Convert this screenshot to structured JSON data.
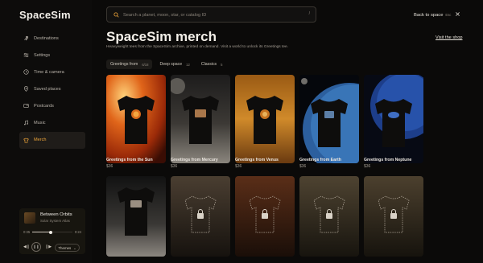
{
  "app": {
    "name": "SpaceSim"
  },
  "sidebar": {
    "items": [
      {
        "label": "Destinations",
        "icon": "rocket-icon"
      },
      {
        "label": "Settings",
        "icon": "sliders-icon"
      },
      {
        "label": "Time & camera",
        "icon": "clock-icon"
      },
      {
        "label": "Saved places",
        "icon": "pin-icon"
      },
      {
        "label": "Postcards",
        "icon": "postcard-icon"
      },
      {
        "label": "Music",
        "icon": "music-icon"
      },
      {
        "label": "Merch",
        "icon": "tshirt-icon",
        "active": true
      }
    ]
  },
  "player": {
    "title": "Between Orbits",
    "subtitle": "Solar System Atlas",
    "elapsed": "0:35",
    "duration": "0:24",
    "progress": 0.45,
    "themes_label": "Themes"
  },
  "search": {
    "placeholder": "Search a planet, moon, star, or catalog ID",
    "shortcut": "/"
  },
  "header": {
    "back_label": "Back to space",
    "back_key": "Esc"
  },
  "page": {
    "title": "SpaceSim merch",
    "subtitle": "Heavyweight tees from the SpaceSim archive, printed on demand. Visit a world to unlock its Greetings tee.",
    "visit_label": "Visit the shop"
  },
  "tabs": [
    {
      "label": "Greetings from",
      "count": "6/18",
      "active": true
    },
    {
      "label": "Deep space",
      "count": "12"
    },
    {
      "label": "Classics",
      "count": "5"
    }
  ],
  "products": [
    {
      "name": "Greetings from the Sun",
      "price": "$36",
      "theme": "sun"
    },
    {
      "name": "Greetings from Mercury",
      "price": "$36",
      "theme": "mercury"
    },
    {
      "name": "Greetings from Venus",
      "price": "$36",
      "theme": "venus"
    },
    {
      "name": "Greetings from Earth",
      "price": "$36",
      "theme": "earth"
    },
    {
      "name": "Greetings from Neptune",
      "price": "$36",
      "theme": "neptune"
    }
  ],
  "second_row": [
    {
      "state": "unlocked",
      "theme": "moon"
    },
    {
      "state": "locked"
    },
    {
      "state": "locked"
    },
    {
      "state": "locked"
    },
    {
      "state": "locked"
    }
  ],
  "colors": {
    "accent": "#f0a63a",
    "background": "#0b0a09"
  }
}
